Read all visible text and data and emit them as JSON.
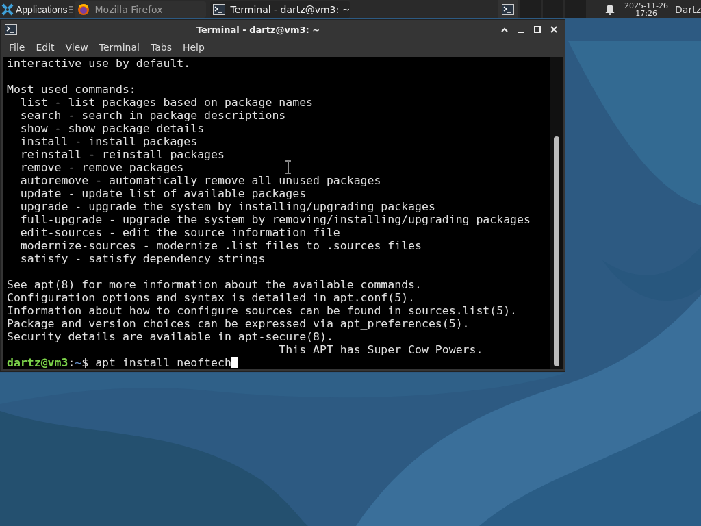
{
  "panel": {
    "apps_label": "Applications",
    "tasks": [
      {
        "label": "Mozilla Firefox",
        "kind": "browser",
        "selected": false
      },
      {
        "label": "Terminal - dartz@vm3: ~",
        "kind": "terminal",
        "selected": true
      }
    ],
    "workspaces": [
      {
        "selected": true
      },
      {
        "selected": false
      },
      {
        "selected": false
      },
      {
        "selected": false
      }
    ],
    "date": "2025-11-26",
    "time": "17:26",
    "user": "Dartz"
  },
  "window": {
    "title": "Terminal - dartz@vm3: ~",
    "menu": [
      "File",
      "Edit",
      "View",
      "Terminal",
      "Tabs",
      "Help"
    ],
    "blocks": [
      [
        "interactive use by default."
      ],
      [
        "Most used commands:",
        "  list - list packages based on package names",
        "  search - search in package descriptions",
        "  show - show package details",
        "  install - install packages",
        "  reinstall - reinstall packages",
        "  remove - remove packages",
        "  autoremove - automatically remove all unused packages",
        "  update - update list of available packages",
        "  upgrade - upgrade the system by installing/upgrading packages",
        "  full-upgrade - upgrade the system by removing/installing/upgrading packages",
        "  edit-sources - edit the source information file",
        "  modernize-sources - modernize .list files to .sources files",
        "  satisfy - satisfy dependency strings"
      ],
      [
        "See apt(8) for more information about the available commands.",
        "Configuration options and syntax is detailed in apt.conf(5).",
        "Information about how to configure sources can be found in sources.list(5).",
        "Package and version choices can be expressed via apt_preferences(5).",
        "Security details are available in apt-secure(8).",
        "                                        This APT has Super Cow Powers."
      ]
    ],
    "prompt": {
      "user_host": "dartz@vm3",
      "separator": ":",
      "path": "~",
      "symbol": "$",
      "command": "apt install neoftech"
    }
  }
}
